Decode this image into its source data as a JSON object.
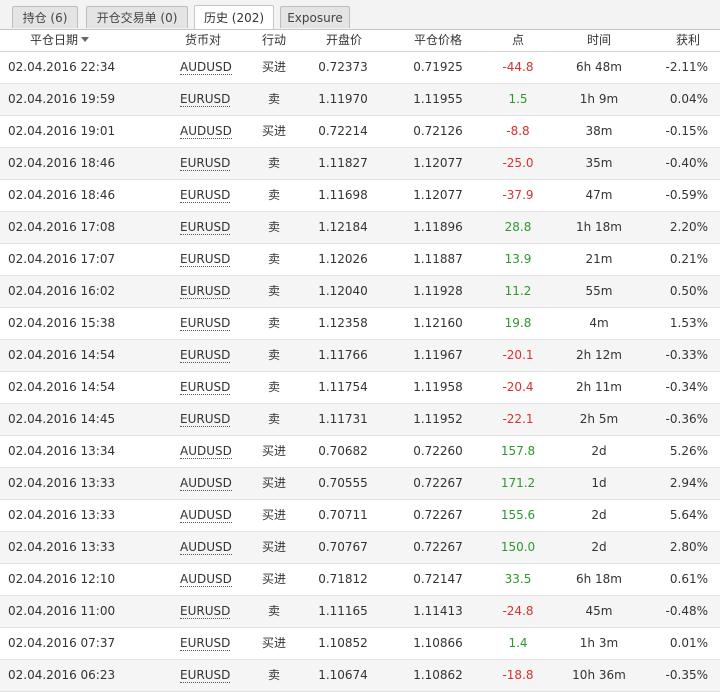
{
  "tabs": [
    {
      "label": "持仓 (6)",
      "active": false
    },
    {
      "label": "开仓交易单 (0)",
      "active": false
    },
    {
      "label": "历史 (202)",
      "active": true
    },
    {
      "label": "Exposure",
      "active": false
    }
  ],
  "columns": {
    "close_date": "平仓日期",
    "symbol": "货币对",
    "action": "行动",
    "open_price": "开盘价",
    "close_price": "平仓价格",
    "points": "点",
    "duration": "时间",
    "profit": "获利"
  },
  "colors": {
    "positive": "#2b9a2b",
    "negative": "#d9302f"
  },
  "rows": [
    {
      "date": "02.04.2016 22:34",
      "symbol": "AUDUSD",
      "action": "买进",
      "open": "0.72373",
      "close": "0.71925",
      "points": "-44.8",
      "duration": "6h 48m",
      "profit": "-2.11%"
    },
    {
      "date": "02.04.2016 19:59",
      "symbol": "EURUSD",
      "action": "卖",
      "open": "1.11970",
      "close": "1.11955",
      "points": "1.5",
      "duration": "1h 9m",
      "profit": "0.04%"
    },
    {
      "date": "02.04.2016 19:01",
      "symbol": "AUDUSD",
      "action": "买进",
      "open": "0.72214",
      "close": "0.72126",
      "points": "-8.8",
      "duration": "38m",
      "profit": "-0.15%"
    },
    {
      "date": "02.04.2016 18:46",
      "symbol": "EURUSD",
      "action": "卖",
      "open": "1.11827",
      "close": "1.12077",
      "points": "-25.0",
      "duration": "35m",
      "profit": "-0.40%"
    },
    {
      "date": "02.04.2016 18:46",
      "symbol": "EURUSD",
      "action": "卖",
      "open": "1.11698",
      "close": "1.12077",
      "points": "-37.9",
      "duration": "47m",
      "profit": "-0.59%"
    },
    {
      "date": "02.04.2016 17:08",
      "symbol": "EURUSD",
      "action": "卖",
      "open": "1.12184",
      "close": "1.11896",
      "points": "28.8",
      "duration": "1h 18m",
      "profit": "2.20%"
    },
    {
      "date": "02.04.2016 17:07",
      "symbol": "EURUSD",
      "action": "卖",
      "open": "1.12026",
      "close": "1.11887",
      "points": "13.9",
      "duration": "21m",
      "profit": "0.21%"
    },
    {
      "date": "02.04.2016 16:02",
      "symbol": "EURUSD",
      "action": "卖",
      "open": "1.12040",
      "close": "1.11928",
      "points": "11.2",
      "duration": "55m",
      "profit": "0.50%"
    },
    {
      "date": "02.04.2016 15:38",
      "symbol": "EURUSD",
      "action": "卖",
      "open": "1.12358",
      "close": "1.12160",
      "points": "19.8",
      "duration": "4m",
      "profit": "1.53%"
    },
    {
      "date": "02.04.2016 14:54",
      "symbol": "EURUSD",
      "action": "卖",
      "open": "1.11766",
      "close": "1.11967",
      "points": "-20.1",
      "duration": "2h 12m",
      "profit": "-0.33%"
    },
    {
      "date": "02.04.2016 14:54",
      "symbol": "EURUSD",
      "action": "卖",
      "open": "1.11754",
      "close": "1.11958",
      "points": "-20.4",
      "duration": "2h 11m",
      "profit": "-0.34%"
    },
    {
      "date": "02.04.2016 14:45",
      "symbol": "EURUSD",
      "action": "卖",
      "open": "1.11731",
      "close": "1.11952",
      "points": "-22.1",
      "duration": "2h 5m",
      "profit": "-0.36%"
    },
    {
      "date": "02.04.2016 13:34",
      "symbol": "AUDUSD",
      "action": "买进",
      "open": "0.70682",
      "close": "0.72260",
      "points": "157.8",
      "duration": "2d",
      "profit": "5.26%"
    },
    {
      "date": "02.04.2016 13:33",
      "symbol": "AUDUSD",
      "action": "买进",
      "open": "0.70555",
      "close": "0.72267",
      "points": "171.2",
      "duration": "1d",
      "profit": "2.94%"
    },
    {
      "date": "02.04.2016 13:33",
      "symbol": "AUDUSD",
      "action": "买进",
      "open": "0.70711",
      "close": "0.72267",
      "points": "155.6",
      "duration": "2d",
      "profit": "5.64%"
    },
    {
      "date": "02.04.2016 13:33",
      "symbol": "AUDUSD",
      "action": "买进",
      "open": "0.70767",
      "close": "0.72267",
      "points": "150.0",
      "duration": "2d",
      "profit": "2.80%"
    },
    {
      "date": "02.04.2016 12:10",
      "symbol": "AUDUSD",
      "action": "买进",
      "open": "0.71812",
      "close": "0.72147",
      "points": "33.5",
      "duration": "6h 18m",
      "profit": "0.61%"
    },
    {
      "date": "02.04.2016 11:00",
      "symbol": "EURUSD",
      "action": "卖",
      "open": "1.11165",
      "close": "1.11413",
      "points": "-24.8",
      "duration": "45m",
      "profit": "-0.48%"
    },
    {
      "date": "02.04.2016 07:37",
      "symbol": "EURUSD",
      "action": "买进",
      "open": "1.10852",
      "close": "1.10866",
      "points": "1.4",
      "duration": "1h 3m",
      "profit": "0.01%"
    },
    {
      "date": "02.04.2016 06:23",
      "symbol": "EURUSD",
      "action": "卖",
      "open": "1.10674",
      "close": "1.10862",
      "points": "-18.8",
      "duration": "10h 36m",
      "profit": "-0.35%"
    }
  ]
}
